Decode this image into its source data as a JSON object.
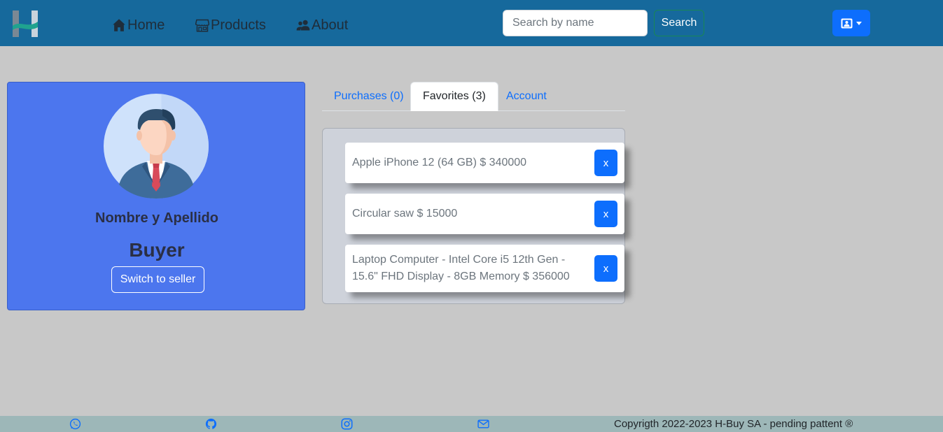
{
  "navbar": {
    "links": [
      {
        "label": "Home",
        "icon": "house-icon"
      },
      {
        "label": "Products",
        "icon": "shop-icon"
      },
      {
        "label": "About",
        "icon": "people-icon"
      }
    ],
    "search": {
      "placeholder": "Search by name",
      "value": "",
      "button_label": "Search"
    },
    "user_menu_icon": "person-card-icon"
  },
  "profile": {
    "name": "Nombre y Apellido",
    "role": "Buyer",
    "switch_label": "Switch to seller"
  },
  "tabs": [
    {
      "label": "Purchases (0)",
      "active": false
    },
    {
      "label": "Favorites (3)",
      "active": true
    },
    {
      "label": "Account",
      "active": false
    }
  ],
  "favorites": [
    {
      "text": "Apple iPhone 12 (64 GB) $ 340000",
      "remove_label": "x"
    },
    {
      "text": "Circular saw $ 15000",
      "remove_label": "x"
    },
    {
      "text": "Laptop Computer - Intel Core i5 12th Gen - 15.6\" FHD Display - 8GB Memory $ 356000",
      "remove_label": "x"
    }
  ],
  "footer": {
    "icons": [
      "whatsapp-icon",
      "github-icon",
      "instagram-icon",
      "envelope-icon"
    ],
    "copyright": "Copyrigth 2022-2023 H-Buy SA - pending pattent ®"
  },
  "colors": {
    "navbar": "#16699c",
    "profile_card": "#4c76ee",
    "primary": "#0d6efd",
    "footer": "#9db7b8",
    "background": "#c8c8c8"
  }
}
